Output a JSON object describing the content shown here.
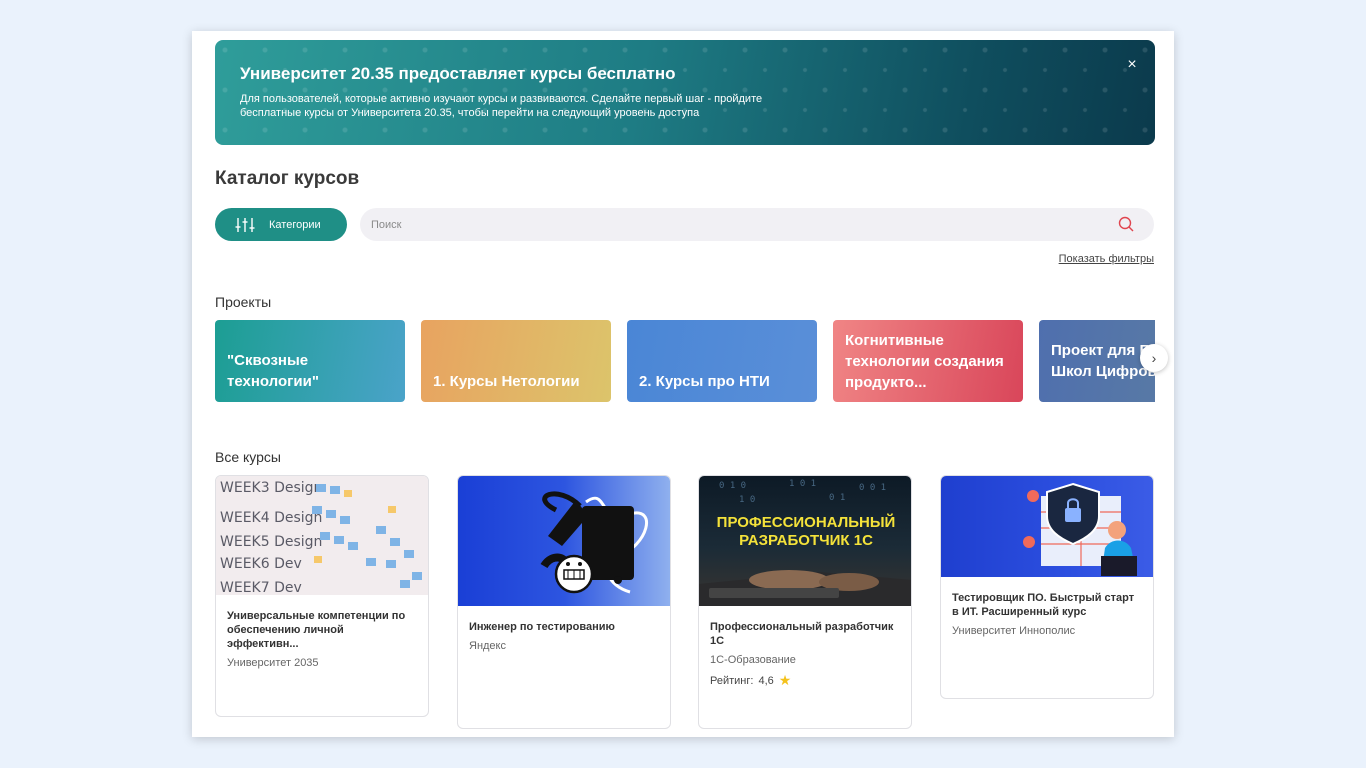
{
  "banner": {
    "title": "Университет 20.35 предоставляет курсы бесплатно",
    "text": "Для пользователей, которые активно изучают курсы и развиваются. Сделайте первый шаг - пройдите бесплатные курсы от Университета 20.35, чтобы перейти на следующий уровень доступа",
    "close_label": "×"
  },
  "catalog": {
    "title": "Каталог курсов",
    "categories_label": "Категории",
    "search_placeholder": "Поиск",
    "show_filters": "Показать фильтры"
  },
  "projects": {
    "title": "Проекты",
    "items": [
      {
        "label": "\"Сквозные технологии\"",
        "color1": "#1c9e93",
        "color2": "#4aa3c9"
      },
      {
        "label": "1. Курсы Нетологии",
        "color1": "#e8a360",
        "color2": "#dcc46b"
      },
      {
        "label": "2. Курсы про НТИ",
        "color1": "#4a86d6",
        "color2": "#5a8fd8"
      },
      {
        "label": "Когнитивные технологии создания продукто...",
        "color1": "#f08585",
        "color2": "#d9465a"
      },
      {
        "label": "Проект для Б поток: Школ Цифровой...",
        "color1": "#4f6fae",
        "color2": "#5d7fa0"
      }
    ],
    "next_arrow": "›"
  },
  "courses": {
    "title": "Все курсы",
    "items": [
      {
        "title": "Универсальные компетенции по обеспечению личной эффективн...",
        "provider": "Университет 2035",
        "rating_label": "",
        "rating": ""
      },
      {
        "title": "Инженер по тестированию",
        "provider": "Яндекс",
        "rating_label": "",
        "rating": ""
      },
      {
        "title": "Профессиональный разработчик 1С",
        "provider": "1С-Образование",
        "rating_label": "Рейтинг:",
        "rating": "4,6"
      },
      {
        "title": "Тестировщик ПО. Быстрый старт в ИТ. Расширенный курс",
        "provider": "Университет Иннополис",
        "rating_label": "",
        "rating": ""
      }
    ],
    "thumb3_text_line1": "ПРОФЕССИОНАЛЬНЫЙ",
    "thumb3_text_line2": "РАЗРАБОТЧИК 1С",
    "thumb1_text": [
      "WEEK3 Design",
      "WEEK4 Design",
      "WEEK5 Design",
      "WEEK6 Dev",
      "WEEK7 Dev"
    ]
  }
}
